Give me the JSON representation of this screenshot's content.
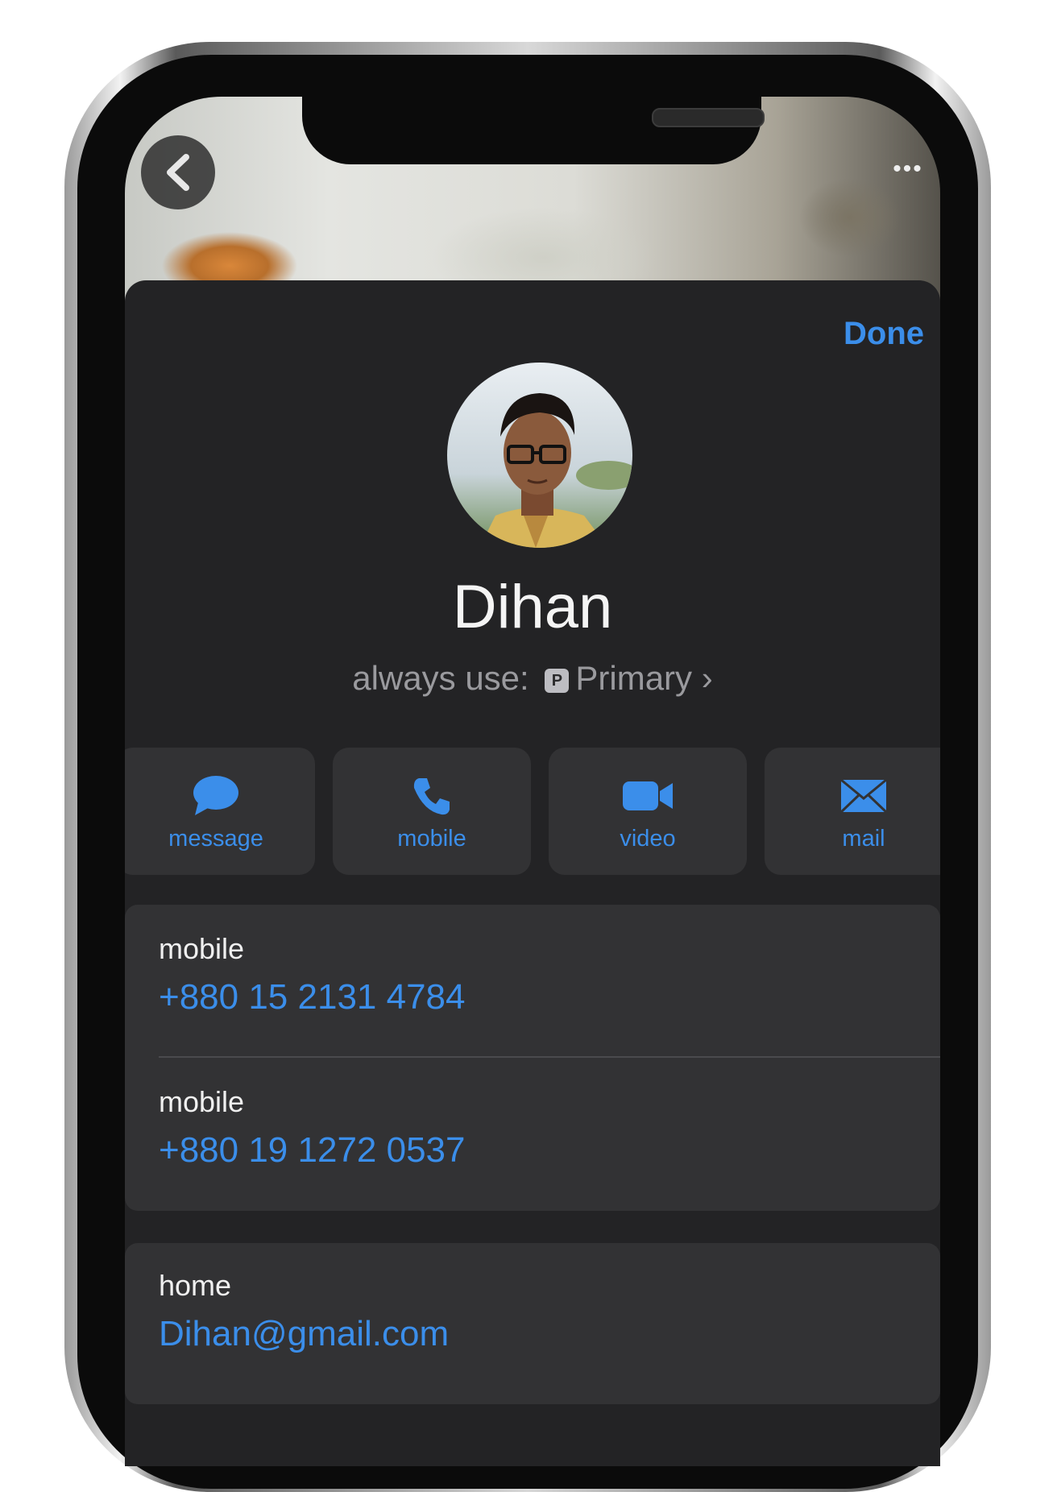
{
  "header": {
    "back_icon": "chevron-left-icon",
    "more_icon": "ellipsis-icon",
    "more_label": "•••",
    "done_label": "Done"
  },
  "contact": {
    "name": "Dihan",
    "always_use_prefix": "always use:",
    "always_use_badge": "P",
    "always_use_value": "Primary",
    "always_use_chevron": "›"
  },
  "actions": [
    {
      "label": "message",
      "icon": "message-bubble-icon"
    },
    {
      "label": "mobile",
      "icon": "phone-icon"
    },
    {
      "label": "video",
      "icon": "video-camera-icon"
    },
    {
      "label": "mail",
      "icon": "envelope-icon"
    }
  ],
  "phones": [
    {
      "label": "mobile",
      "value": "+880 15 2131 4784"
    },
    {
      "label": "mobile",
      "value": "+880 19 1272 0537"
    }
  ],
  "email": {
    "label": "home",
    "value": "Dihan@gmail.com"
  },
  "colors": {
    "accent": "#3b8eea",
    "sheet_bg": "#232325",
    "card_bg": "#323234"
  }
}
